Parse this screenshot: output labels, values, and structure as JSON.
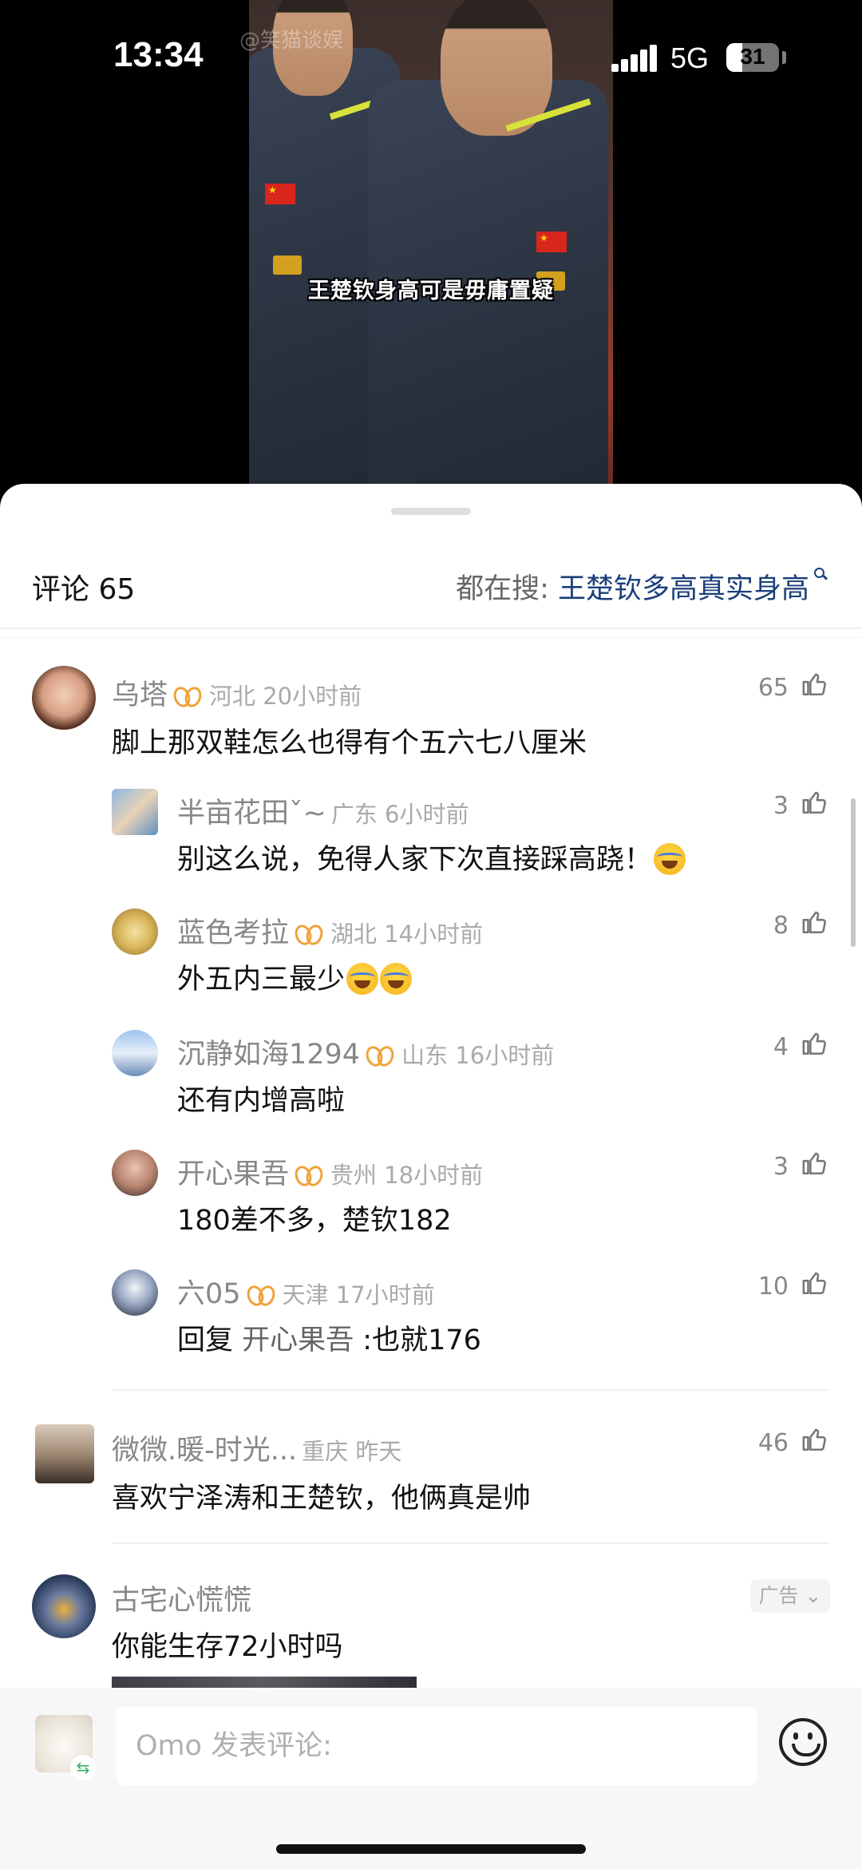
{
  "status_bar": {
    "time": "13:34",
    "network": "5G",
    "battery": "31",
    "battery_level": 0.31
  },
  "video": {
    "caption": "王楚钦身高可是毋庸置疑",
    "watermark": "@笑猫谈娱"
  },
  "header": {
    "comments_label": "评论 65",
    "trending_prefix": "都在搜: ",
    "trending_query": "王楚钦多高真实身高"
  },
  "comments": [
    {
      "user": "乌塔",
      "vip": true,
      "meta": "河北 20小时前",
      "text": "脚上那双鞋怎么也得有个五六七八厘米",
      "likes": "65"
    },
    {
      "user": "半亩花田ˇ~",
      "vip": false,
      "meta": "广东 6小时前",
      "text": "别这么说，免得人家下次直接踩高跷！",
      "likes": "3",
      "emoji": 1
    },
    {
      "user": "蓝色考拉",
      "vip": true,
      "meta": "湖北 14小时前",
      "text": "外五内三最少",
      "likes": "8",
      "emoji": 2
    },
    {
      "user": "沉静如海1294",
      "vip": true,
      "meta": "山东 16小时前",
      "text": "还有内增高啦",
      "likes": "4"
    },
    {
      "user": "开心果吾",
      "vip": true,
      "meta": "贵州 18小时前",
      "text": "180差不多，楚钦182",
      "likes": "3"
    },
    {
      "user": "六05",
      "vip": true,
      "meta": "天津 17小时前",
      "text_prefix": "回复 ",
      "mention": "开心果吾",
      "text": " :也就176",
      "likes": "10"
    },
    {
      "user": "微微.暖-时光...",
      "vip": false,
      "meta": "重庆 昨天",
      "text": "喜欢宁泽涛和王楚钦，他俩真是帅",
      "likes": "46"
    },
    {
      "user": "古宅心慌慌",
      "vip": false,
      "meta": "",
      "text": "你能生存72小时吗",
      "ad_label": "广告 ⌄"
    }
  ],
  "input": {
    "placeholder": "Omo 发表评论:"
  },
  "icons": {
    "like": "thumb-up-icon",
    "vip": "vip-badge-icon",
    "emoji": "emoji-face-icon",
    "search": "search-icon"
  }
}
